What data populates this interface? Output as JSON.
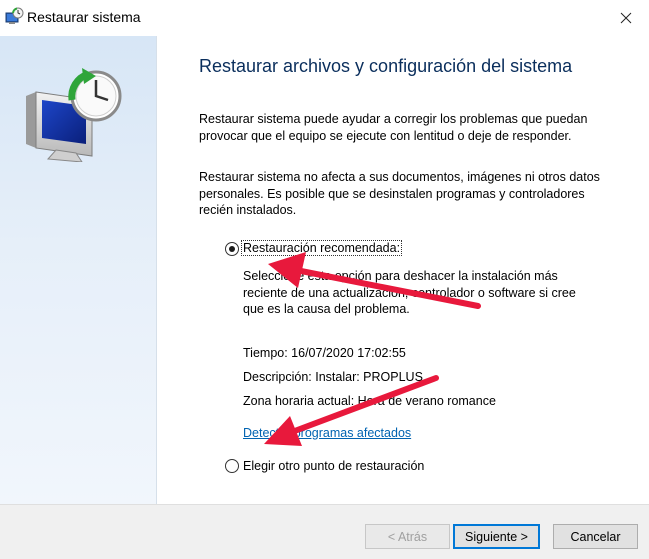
{
  "window": {
    "title": "Restaurar sistema"
  },
  "heading": "Restaurar archivos y configuración del sistema",
  "paragraphs": [
    "Restaurar sistema puede ayudar a corregir los problemas que puedan provocar que el equipo se ejecute con lentitud o deje de responder.",
    "Restaurar sistema no afecta a sus documentos, imágenes ni otros datos personales. Es posible que se desinstalen programas y controladores recién instalados."
  ],
  "options": {
    "recommended": {
      "label": "Restauración recomendada:",
      "selected": true,
      "description": "Seleccione esta opción para deshacer la instalación más reciente de una actualización, controlador o software si cree que es la causa del problema.",
      "time": "Tiempo: 16/07/2020 17:02:55",
      "description_line": "Descripción: Instalar: PROPLUS",
      "timezone": "Zona horaria actual: Hora de verano romance",
      "link": "Detectar programas afectados"
    },
    "other": {
      "label": "Elegir otro punto de restauración",
      "selected": false
    }
  },
  "buttons": {
    "back": "< Atrás",
    "next": "Siguiente >",
    "cancel": "Cancelar"
  },
  "colors": {
    "heading": "#0a2e5c",
    "link": "#0063b1",
    "annotation_arrow": "#e8193c",
    "left_pane": "#e0ecf8"
  },
  "icons": [
    "system-restore-icon",
    "close-icon",
    "computer-clock-icon"
  ]
}
